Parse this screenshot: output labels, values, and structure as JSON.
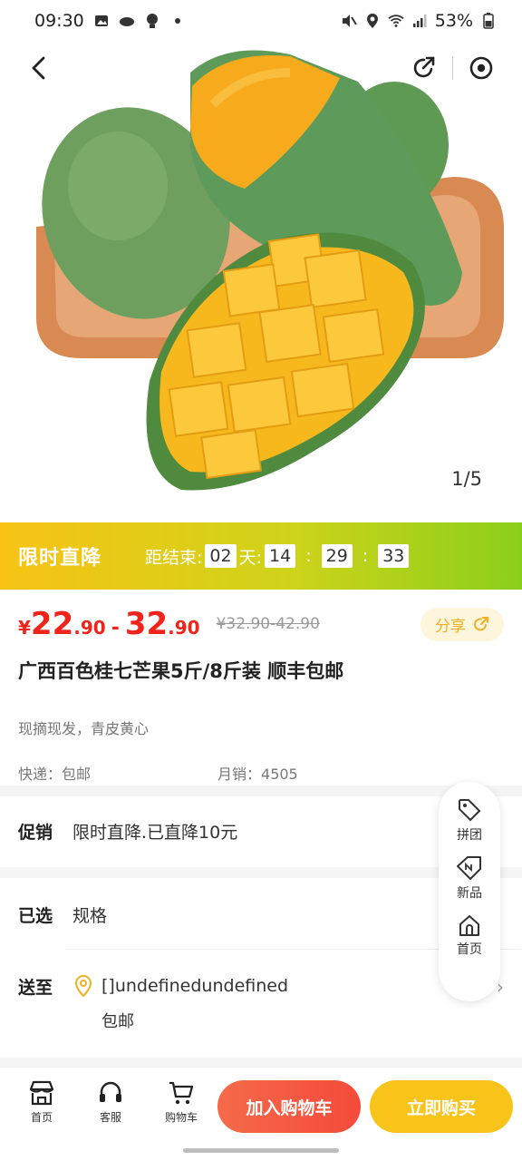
{
  "status": {
    "time": "09:30",
    "battery": "53%",
    "icons_left": [
      "gallery-icon",
      "cloud-icon",
      "bulb-icon",
      "dot-icon"
    ],
    "icons_right": [
      "mute-icon",
      "location-icon",
      "wifi-icon",
      "signal-icon",
      "battery-icon"
    ]
  },
  "hero": {
    "counter": "1/5"
  },
  "flash": {
    "title": "限时直降",
    "ends_label": "距结束:",
    "days": "02",
    "day_unit": "天:",
    "hours": "14",
    "minutes": "29",
    "seconds": "33",
    "sep": ":"
  },
  "price": {
    "yen": "¥",
    "low_int": "22",
    "low_dec": ".90",
    "dash": "-",
    "high_int": "32",
    "high_dec": ".90",
    "original": "¥32.90-42.90",
    "share_label": "分享"
  },
  "product": {
    "title": "广西百色桂七芒果5斤/8斤装 顺丰包邮",
    "subtitle": "现摘现发，青皮黄心",
    "shipping": "快递：包邮",
    "monthly_sales": "月销：4505"
  },
  "promo": {
    "label": "促销",
    "value": "限时直降.已直降10元"
  },
  "selected": {
    "label": "已选",
    "value": "规格"
  },
  "delivery": {
    "label": "送至",
    "address": "[]undefinedundefined",
    "shipping": "包邮"
  },
  "float_menu": {
    "items": [
      {
        "label": "拼团",
        "icon": "tag-icon"
      },
      {
        "label": "新品",
        "icon": "new-tag-icon"
      },
      {
        "label": "首页",
        "icon": "home-icon"
      }
    ]
  },
  "bottom": {
    "tabs": [
      {
        "label": "首页",
        "icon": "store-icon"
      },
      {
        "label": "客服",
        "icon": "headset-icon"
      },
      {
        "label": "购物车",
        "icon": "cart-icon"
      }
    ],
    "add_cart": "加入购物车",
    "buy_now": "立即购买"
  },
  "colors": {
    "price_red": "#f0241b",
    "flash_start": "#f8c315",
    "flash_end": "#8bcf1b",
    "cart_button": "#f44a3a",
    "buy_button": "#f8c41a"
  }
}
